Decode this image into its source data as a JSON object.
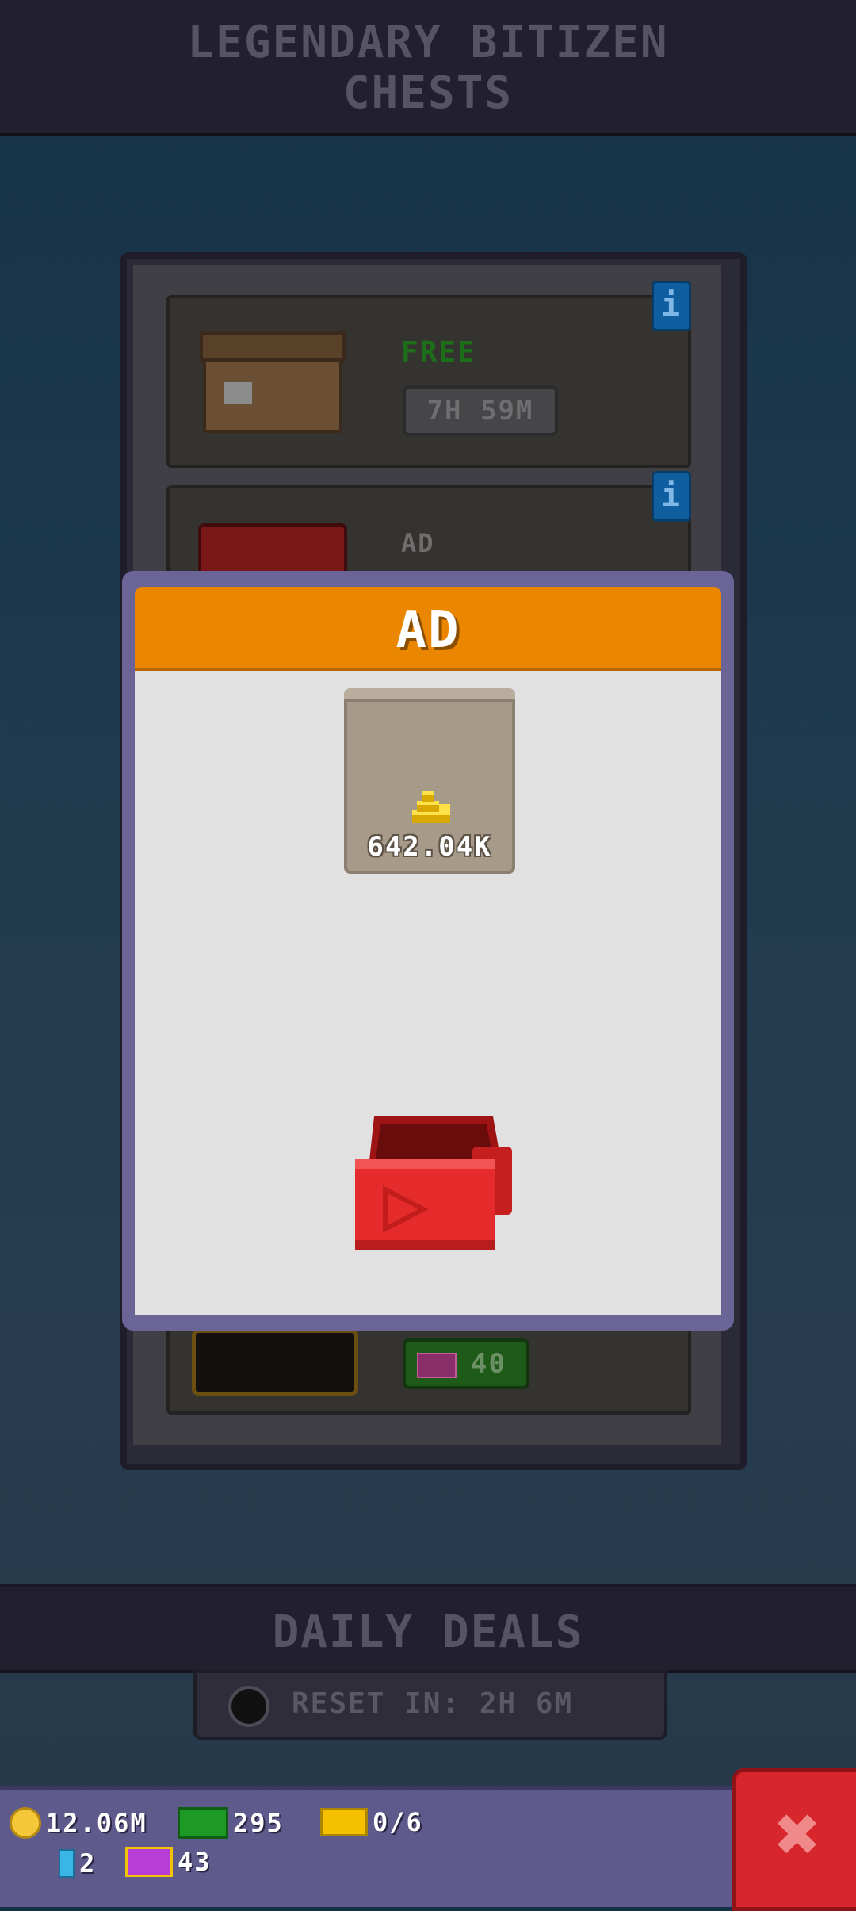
{
  "header": {
    "title": "LEGENDARY BITIZEN\nCHESTS"
  },
  "chest_list": {
    "info_icon": "i",
    "free_chest": {
      "label": "FREE",
      "timer": "7H 59M"
    },
    "ad_chest": {
      "label": "AD"
    },
    "premium_chest": {
      "price": "40"
    }
  },
  "modal": {
    "title": "AD",
    "reward": {
      "amount": "642.04K",
      "icon": "coin-stack-icon"
    },
    "chest_icon": "red-play-chest-icon"
  },
  "daily_deals": {
    "title": "DAILY DEALS",
    "reset_text": "RESET IN: 2H 6M"
  },
  "currency_bar": {
    "coins": "12.06M",
    "bux": "295",
    "tickets": "0/6",
    "gems": "2",
    "golden_tickets": "43"
  },
  "close_button": {
    "icon": "close-x-icon"
  },
  "colors": {
    "header_orange": "#ea8600",
    "modal_frame": "#6b6496",
    "close_red": "#d7262c"
  }
}
